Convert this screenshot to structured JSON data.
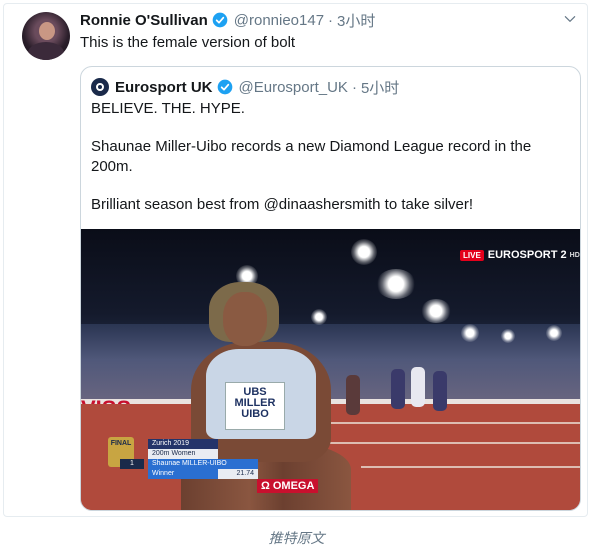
{
  "tweet": {
    "display_name": "Ronnie O'Sullivan",
    "handle": "@ronnieo147",
    "separator": "·",
    "time": "3小时",
    "text": "This is the female version of bolt"
  },
  "quoted_tweet": {
    "display_name": "Eurosport UK",
    "handle": "@Eurosport_UK",
    "separator": "·",
    "time": "5小时",
    "paragraphs": [
      "BELIEVE. THE. HYPE.",
      "Shaunae Miller-Uibo records a new Diamond League record in the 200m.",
      "Brilliant season best from @dinaashersmith to take silver!"
    ]
  },
  "video_overlay": {
    "live_badge": "LIVE",
    "broadcaster": "EUROSPORT 2",
    "hd": "HD",
    "ad_board": "VISS",
    "bib_line1": "UBS",
    "bib_line2": "MILLER",
    "bib_line3": "UIBO",
    "final_badge": "FINAL",
    "location": "Zurich 2019",
    "event": "200m Women",
    "rank": "1",
    "athlete_name": "Shaunae MILLER-UIBO",
    "result_label": "Winner",
    "result_time": "21.74",
    "sponsor": "Ω OMEGA"
  },
  "translate_link": "推特原文",
  "colors": {
    "verified": "#1da1f2",
    "secondary_text": "#657786",
    "border": "#ccd6dd"
  },
  "icons": {
    "verified": "verified-badge-icon",
    "menu": "chevron-down-icon"
  }
}
